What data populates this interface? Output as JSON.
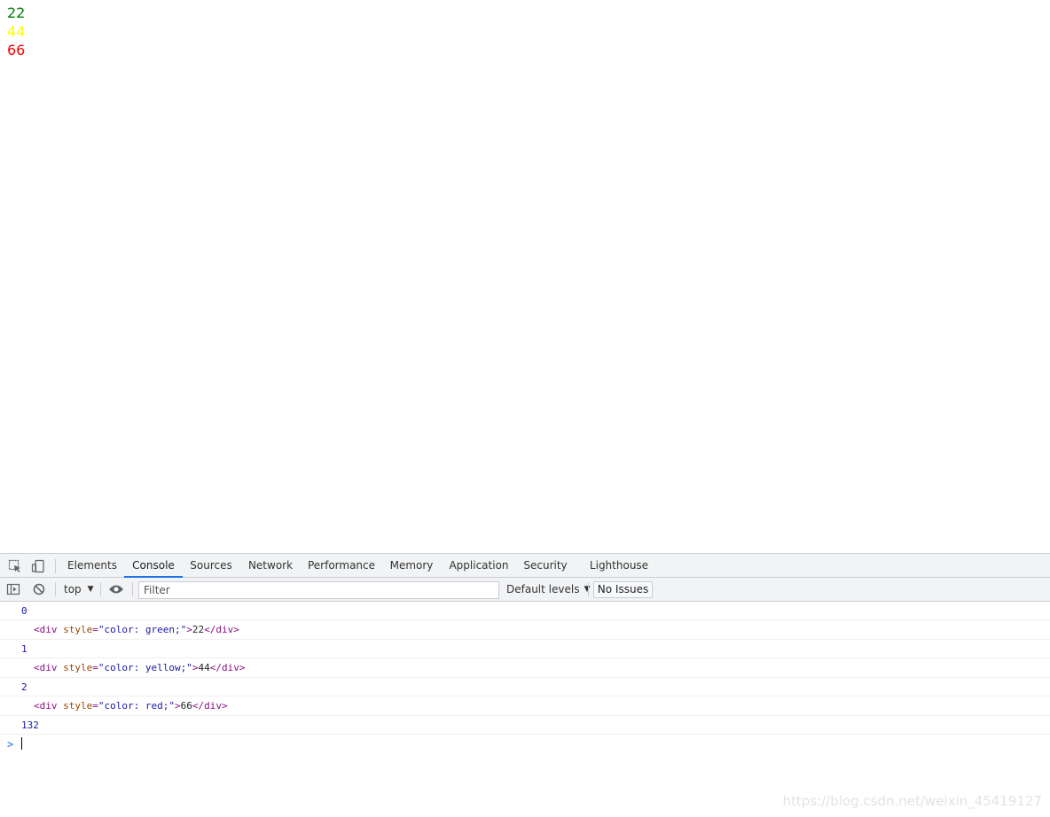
{
  "page": {
    "lines": [
      {
        "text": "22",
        "color": "#008000"
      },
      {
        "text": "44",
        "color": "#ffff00"
      },
      {
        "text": "66",
        "color": "#ff0000"
      }
    ]
  },
  "devtools": {
    "toolbar_icons": [
      "inspect-element-icon",
      "device-toolbar-icon"
    ],
    "tabs": [
      "Elements",
      "Console",
      "Sources",
      "Network",
      "Performance",
      "Memory",
      "Application",
      "Security",
      "Lighthouse"
    ],
    "active_tab": "Console",
    "console_toolbar": {
      "context": "top",
      "filter_placeholder": "Filter",
      "levels": "Default levels",
      "issues": "No Issues"
    },
    "log": {
      "n0": "0",
      "n1": "1",
      "n2": "2",
      "total": "132",
      "el0": {
        "open": "<div ",
        "attr": "style",
        "eq": "=",
        "val": "\"color: green;\"",
        "close_open": ">",
        "text": "22",
        "close": "</div>"
      },
      "el1": {
        "open": "<div ",
        "attr": "style",
        "eq": "=",
        "val": "\"color: yellow;\"",
        "close_open": ">",
        "text": "44",
        "close": "</div>"
      },
      "el2": {
        "open": "<div ",
        "attr": "style",
        "eq": "=",
        "val": "\"color: red;\"",
        "close_open": ">",
        "text": "66",
        "close": "</div>"
      }
    },
    "prompt": ">"
  },
  "watermark": "https://blog.csdn.net/weixin_45419127"
}
